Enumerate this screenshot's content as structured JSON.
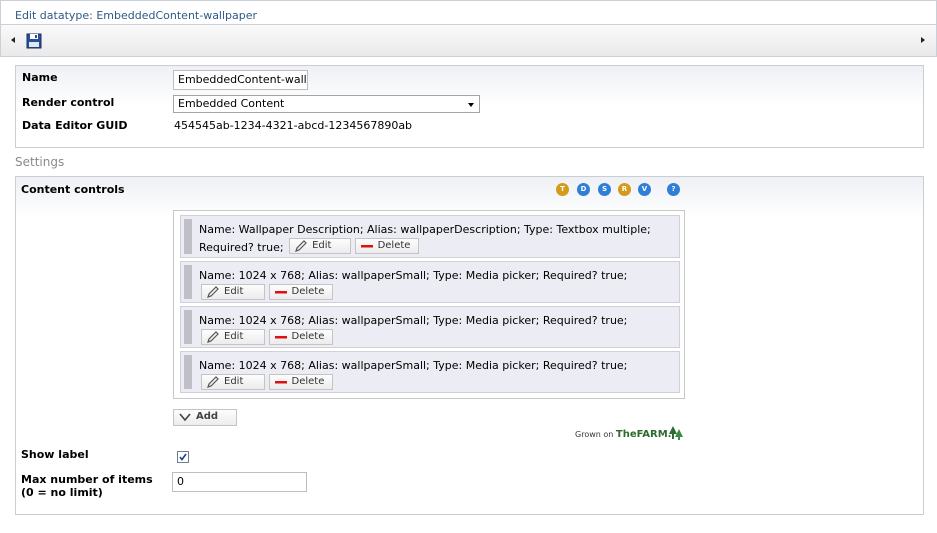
{
  "window": {
    "title": "Edit datatype: EmbeddedContent-wallpaper"
  },
  "toolbar": {
    "save_icon": "save-icon",
    "left_icon": "arrow-left-icon",
    "right_icon": "arrow-right-icon"
  },
  "properties": {
    "name_label": "Name",
    "name_value": "EmbeddedContent-wallpaper",
    "render_label": "Render control",
    "render_value": "Embedded Content",
    "guid_label": "Data Editor GUID",
    "guid_value": "454545ab-1234-4321-abcd-1234567890ab"
  },
  "settings": {
    "heading": "Settings",
    "content_controls_label": "Content controls",
    "help_icons": [
      "T",
      "D",
      "S",
      "R",
      "V",
      "?"
    ],
    "items": [
      {
        "text": "Name: Wallpaper Description; Alias: wallpaperDescription; Type: Textbox multiple; Required? true;"
      },
      {
        "text": "Name: 1024 x 768; Alias: wallpaperSmall; Type: Media picker; Required? true;"
      },
      {
        "text": "Name: 1024 x 768; Alias: wallpaperSmall; Type: Media picker; Required? true;"
      },
      {
        "text": "Name: 1024 x 768; Alias: wallpaperSmall; Type: Media picker; Required? true;"
      }
    ],
    "edit_label": "Edit",
    "delete_label": "Delete",
    "add_label": "Add",
    "farm_prefix": "Grown on",
    "farm_brand": "TheFARM.",
    "show_label_label": "Show label",
    "show_label_checked": true,
    "max_items_label": "Max number of items (0 = no limit)",
    "max_items_value": "0"
  }
}
